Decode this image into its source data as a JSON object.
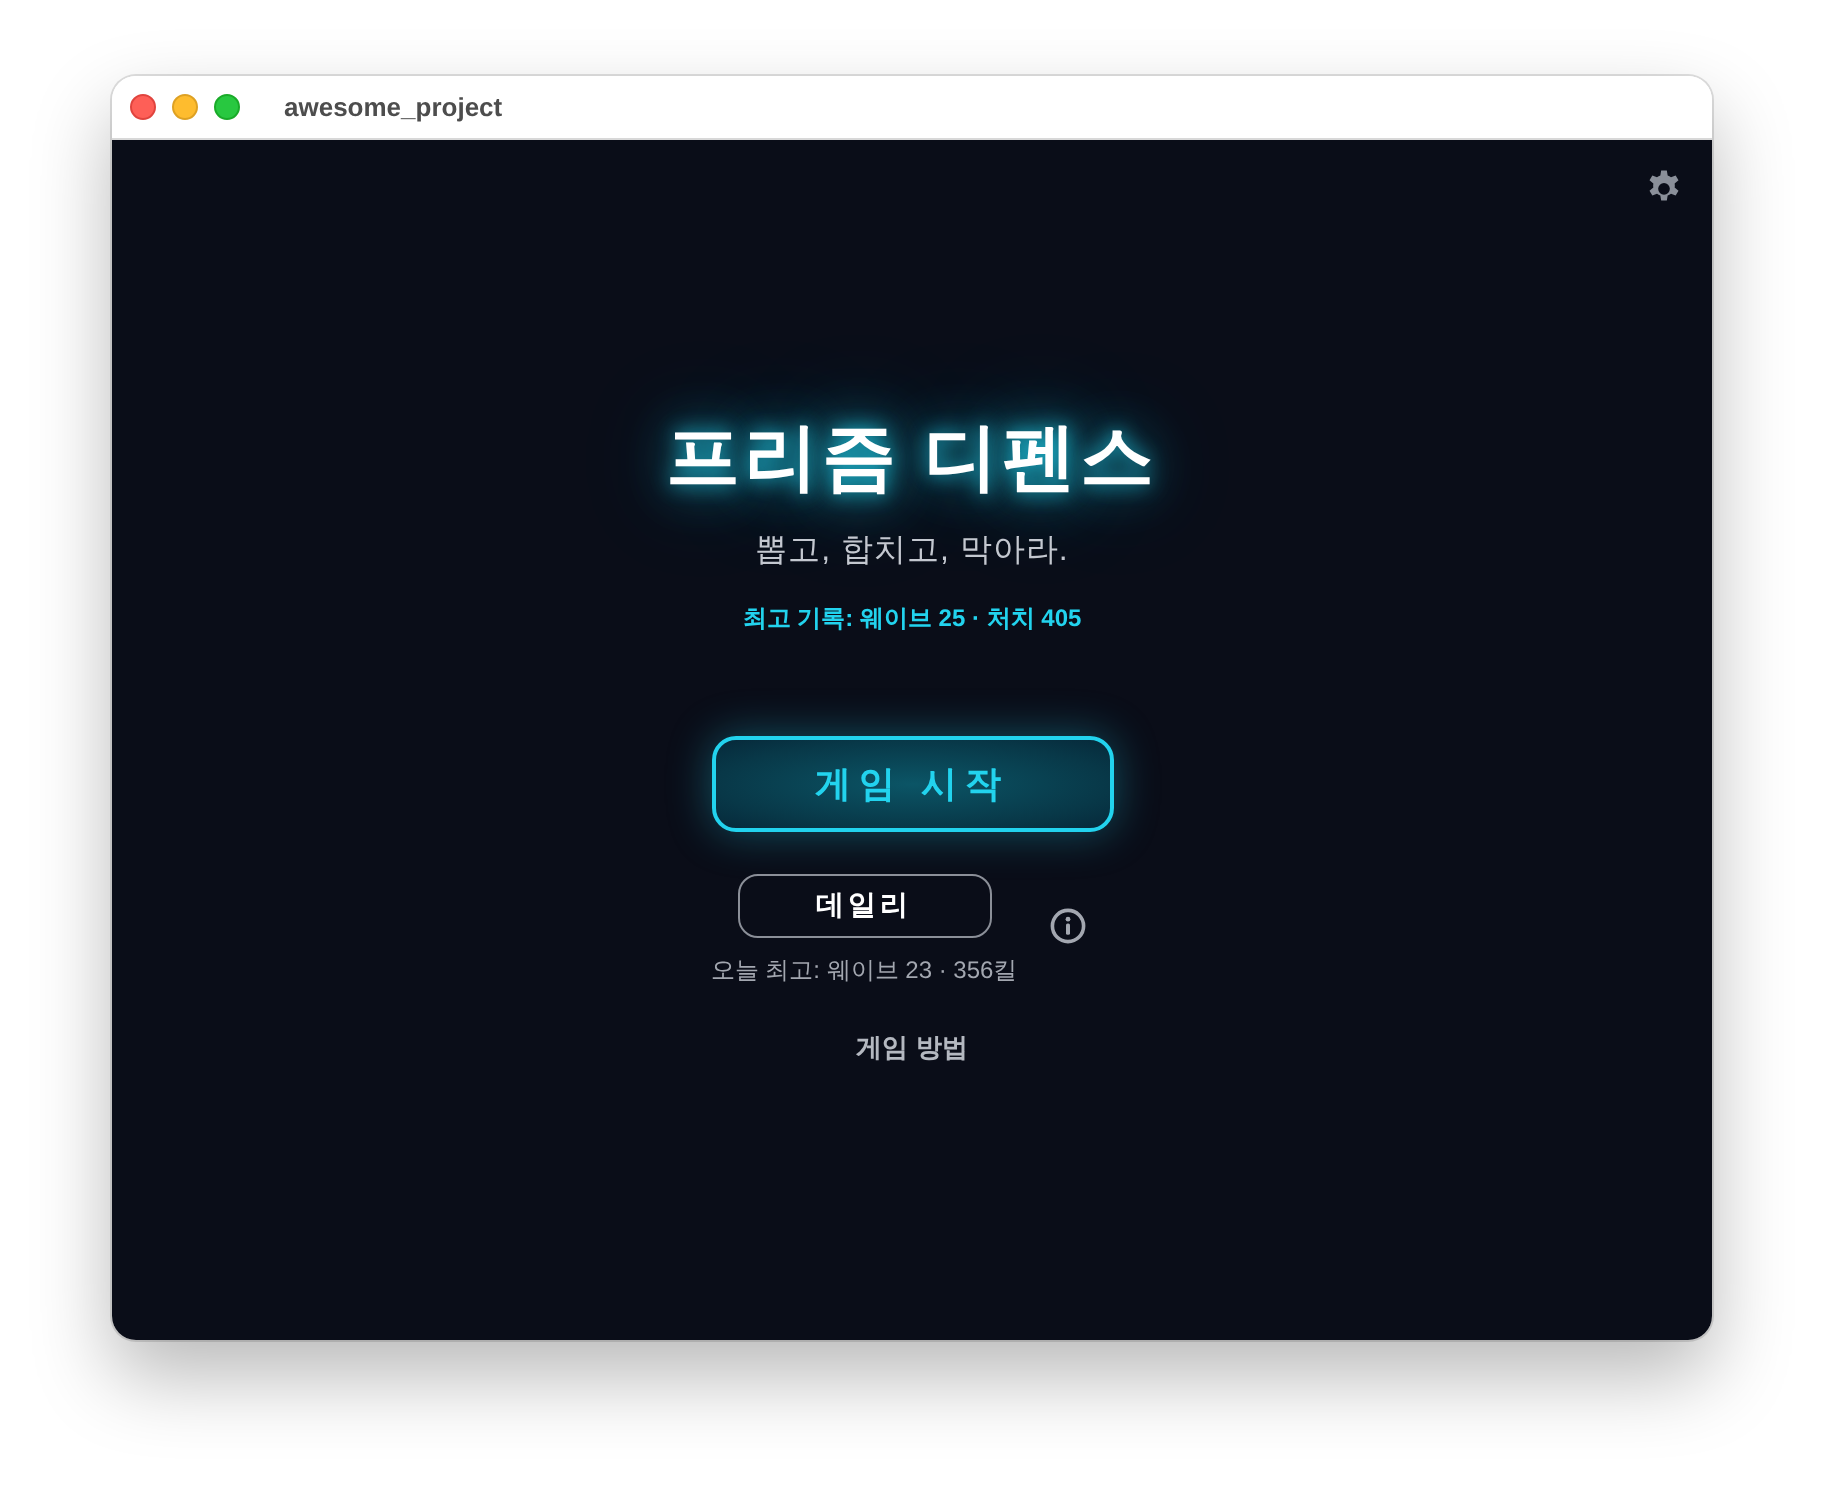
{
  "window": {
    "title": "awesome_project"
  },
  "title": "프리즘 디펜스",
  "tagline": "뽑고, 합치고, 막아라.",
  "best_record": "최고 기록: 웨이브 25 · 처치 405",
  "start_button": "게임 시작",
  "daily": {
    "button": "데일리",
    "caption": "오늘 최고: 웨이브 23 · 356킬"
  },
  "how_to_play": "게임 방법"
}
